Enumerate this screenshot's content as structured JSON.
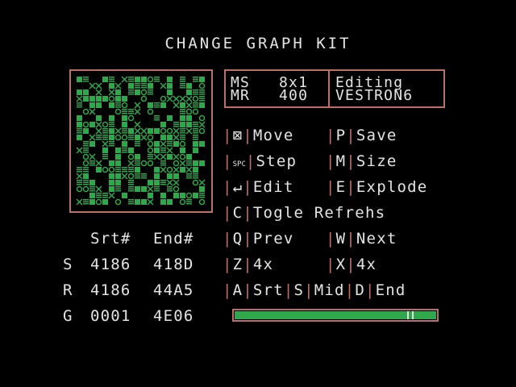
{
  "title": "CHANGE GRAPH KIT",
  "info": {
    "ms_label": "MS",
    "ms_value": "8x1",
    "mr_label": "MR",
    "mr_value": "400",
    "mode": "Editing",
    "name": "VESTRON6"
  },
  "menu": {
    "move_key": "⊠",
    "move_label": "Move",
    "save_key": "P",
    "save_label": "Save",
    "step_key": "SPC",
    "step_label": "Step",
    "size_key": "M",
    "size_label": "Size",
    "edit_key": "↵",
    "edit_label": "Edit",
    "explode_key": "E",
    "explode_label": "Explode",
    "togle_key": "C",
    "togle_label": "Togle Refrehs",
    "prev_key": "Q",
    "prev_label": "Prev",
    "next_key": "W",
    "next_label": "Next",
    "zoom_in_key": "Z",
    "zoom_in_label": "4x",
    "zoom_out_key": "X",
    "zoom_out_label": "4x",
    "srt_key": "A",
    "srt_label": "Srt",
    "mid_key": "S",
    "mid_label": "Mid",
    "end_key": "D",
    "end_label": "End"
  },
  "table": {
    "header_start": "Srt#",
    "header_end": "End#",
    "rows": [
      {
        "label": "S",
        "start": "4186",
        "end": "418D"
      },
      {
        "label": "R",
        "start": "4186",
        "end": "44A5"
      },
      {
        "label": "G",
        "start": "0001",
        "end": "4E06"
      }
    ]
  },
  "progress": {
    "fill_fraction": 1.0,
    "marker_fraction": 0.86
  },
  "colors": {
    "accent": "#c06e63",
    "green": "#2ea84a",
    "text": "#e4e4e4",
    "background": "#000000"
  }
}
